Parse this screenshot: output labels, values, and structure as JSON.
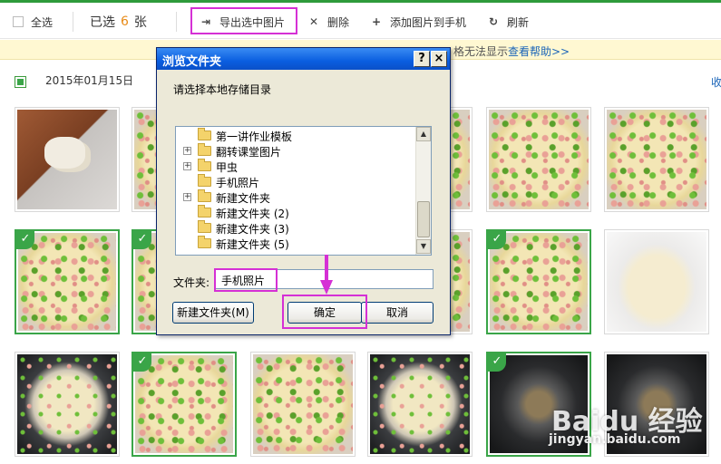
{
  "toolbar": {
    "select_all": "全选",
    "selected_prefix": "已选",
    "selected_count": "6",
    "selected_suffix": "张",
    "export_label": "导出选中图片",
    "delete_label": "删除",
    "add_label": "添加图片到手机",
    "refresh_label": "刷新"
  },
  "notice": {
    "text": "",
    "text_visible": "格无法显示",
    "help_link": "查看帮助>>"
  },
  "group": {
    "date": "2015年01月15日",
    "collapse": "收"
  },
  "dialog": {
    "title": "浏览文件夹",
    "help_btn": "?",
    "close_btn": "×",
    "prompt": "请选择本地存储目录",
    "tree": [
      {
        "label": "第一讲作业模板",
        "expandable": false
      },
      {
        "label": "翻转课堂图片",
        "expandable": true
      },
      {
        "label": "甲虫",
        "expandable": true
      },
      {
        "label": "手机照片",
        "expandable": false
      },
      {
        "label": "新建文件夹",
        "expandable": true
      },
      {
        "label": "新建文件夹 (2)",
        "expandable": false
      },
      {
        "label": "新建文件夹 (3)",
        "expandable": false
      },
      {
        "label": "新建文件夹 (5)",
        "expandable": false
      }
    ],
    "folder_label": "文件夹:",
    "folder_value": "手机照片",
    "new_folder_btn": "新建文件夹(M)",
    "ok_btn": "确定",
    "cancel_btn": "取消"
  },
  "watermark": {
    "brand": "Baidu 经验",
    "url": "jingyan.baidu.com"
  },
  "colors": {
    "accent_green": "#3aa548",
    "highlight": "#d530d5",
    "count": "#e88b18",
    "link": "#1a64b8"
  }
}
